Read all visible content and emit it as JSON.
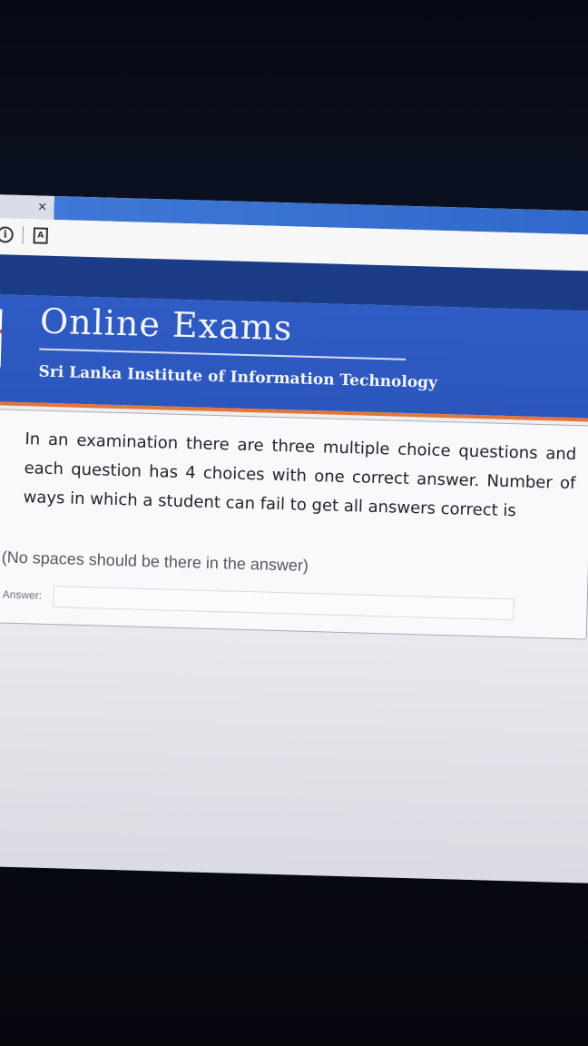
{
  "browser": {
    "tab_close_glyph": "×",
    "info_icon_glyph": "i",
    "page_icon_glyph": "A"
  },
  "header": {
    "logo_glyph": "T",
    "title": "Online Exams",
    "subtitle": "Sri Lanka Institute of Information Technology",
    "colors": {
      "band": "#2f5cc4",
      "dark_band": "#1b3d87",
      "accent_line": "#e2763b"
    }
  },
  "question": {
    "text": "In an examination there are three multiple choice questions and each question has 4 choices with one correct answer. Number of ways in which a student can fail to get all answers correct is",
    "note": "(No spaces should be there in the answer)",
    "answer_label": "Answer:",
    "answer_value": "",
    "answer_placeholder": ""
  }
}
